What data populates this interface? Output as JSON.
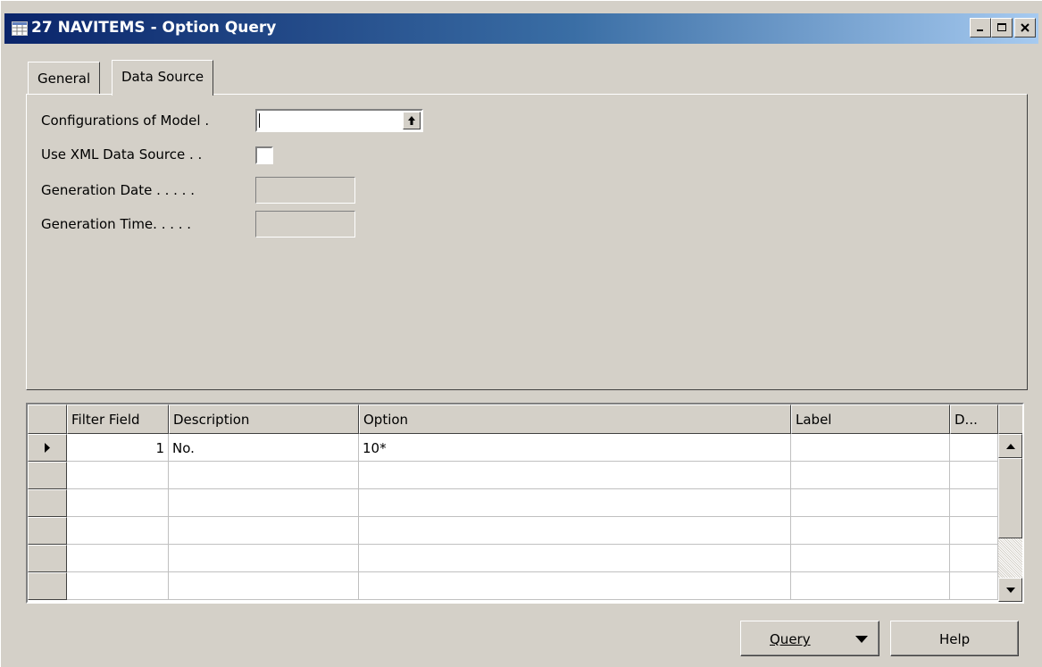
{
  "window": {
    "title": "27 NAVITEMS - Option Query",
    "title_icon": "table-icon",
    "controls": [
      "minimize-icon",
      "maximize-icon",
      "close-icon"
    ]
  },
  "tabs": [
    {
      "label": "General",
      "active": false
    },
    {
      "label": "Data Source",
      "active": true
    }
  ],
  "fields": {
    "configurations_label": "Configurations of Model .",
    "configurations_value": "",
    "use_xml_label": "Use XML Data Source . .",
    "use_xml_checked": false,
    "generation_date_label": "Generation Date . . . . .",
    "generation_date_value": "",
    "generation_time_label": "Generation Time. . . . .",
    "generation_time_value": ""
  },
  "grid": {
    "columns": [
      "Filter Field",
      "Description",
      "Option",
      "Label",
      "D..."
    ],
    "rows": [
      {
        "filter_field": "1",
        "description": "No.",
        "option": "10*",
        "label": "",
        "d": "",
        "current": true
      },
      {
        "filter_field": "",
        "description": "",
        "option": "",
        "label": "",
        "d": "",
        "current": false
      },
      {
        "filter_field": "",
        "description": "",
        "option": "",
        "label": "",
        "d": "",
        "current": false
      },
      {
        "filter_field": "",
        "description": "",
        "option": "",
        "label": "",
        "d": "",
        "current": false
      },
      {
        "filter_field": "",
        "description": "",
        "option": "",
        "label": "",
        "d": "",
        "current": false
      },
      {
        "filter_field": "",
        "description": "",
        "option": "",
        "label": "",
        "d": "",
        "current": false
      }
    ]
  },
  "buttons": {
    "query_label": "Query",
    "help_label": "Help"
  },
  "colors": {
    "face": "#d4d0c8",
    "title_start": "#0a246a",
    "title_end": "#a6caf0"
  }
}
